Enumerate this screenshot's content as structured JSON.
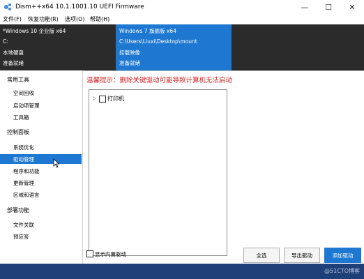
{
  "window": {
    "title": "Dism++x64 10.1.1001.10 UEFI Firmware",
    "minimize_glyph": "—",
    "maximize_glyph": "☐",
    "close_glyph": "✕"
  },
  "menu": {
    "items": [
      "文件(F)",
      "恢复功能(R)",
      "选项(O)",
      "帮助(H)"
    ]
  },
  "images": [
    {
      "lines": [
        "*Windows 10 企业版 x64",
        "C:",
        "本地硬盘",
        "准备就绪"
      ],
      "selected": true
    },
    {
      "lines": [
        "Windows 7 旗舰版 x64",
        "C:\\Users\\Liuxi\\Desktop\\mount",
        "挂载映像",
        "准备就绪"
      ],
      "selected": false
    }
  ],
  "sidebar": {
    "groups": [
      {
        "title": "常用工具",
        "items": [
          "空间回收",
          "启动项管理",
          "工具箱"
        ]
      },
      {
        "title": "控制面板",
        "items": [
          "系统优化",
          "驱动管理",
          "程序和功能",
          "更新管理",
          "区域和语言"
        ]
      },
      {
        "title": "部署功能",
        "items": [
          "文件关联",
          "预应答"
        ]
      }
    ],
    "selected_item": "驱动管理"
  },
  "main": {
    "warning": "温馨提示：删除关键驱动可能导致计算机无法启动",
    "tree": [
      {
        "label": "打印机",
        "checked": false
      }
    ],
    "show_builtin_label": "显示内置驱动",
    "show_builtin_checked": false,
    "buttons": {
      "select_all": "全选",
      "export": "导出驱动",
      "add": "添加驱动"
    }
  },
  "statusbar": {
    "watermark": "@51CTO博客"
  },
  "colors": {
    "accent": "#1e78d2",
    "warning": "#d02020",
    "dark_panel": "#2b2b2b",
    "status_bar": "#1f3f78"
  }
}
